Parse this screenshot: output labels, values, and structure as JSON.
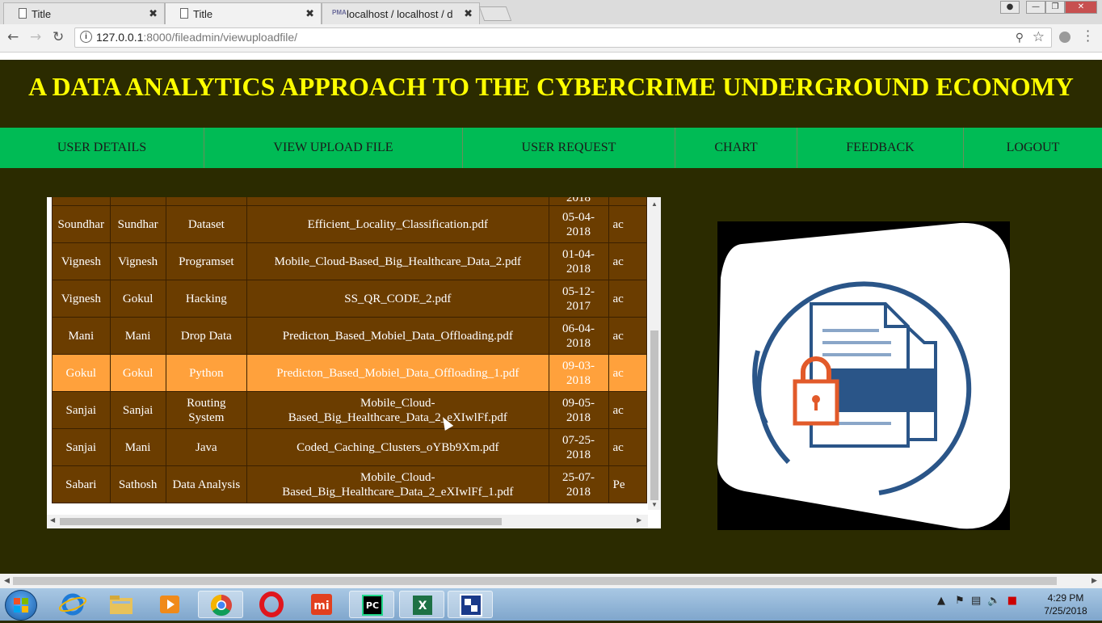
{
  "browser": {
    "tabs": [
      {
        "label": "Title",
        "close": "✖"
      },
      {
        "label": "Title",
        "close": "✖"
      },
      {
        "label": "localhost / localhost / da",
        "close": "✖",
        "badge": "PMA"
      }
    ],
    "url_host": "127.0.0.1",
    "url_rest": ":8000/fileadmin/viewuploadfile/",
    "info_icon": "i"
  },
  "page": {
    "title": "A DATA ANALYTICS APPROACH TO THE CYBERCRIME UNDERGROUND ECONOMY",
    "nav": [
      "USER DETAILS",
      "VIEW UPLOAD FILE",
      "USER REQUEST",
      "CHART",
      "FEEDBACK",
      "LOGOUT"
    ],
    "table": {
      "partial_top_date": "2018",
      "rows": [
        [
          "Soundhar",
          "Sundhar",
          "Dataset",
          "Efficient_Locality_Classification.pdf",
          "05-04-\n2018",
          "ac"
        ],
        [
          "Vignesh",
          "Vignesh",
          "Programset",
          "Mobile_Cloud-Based_Big_Healthcare_Data_2.pdf",
          "01-04-\n2018",
          "ac"
        ],
        [
          "Vignesh",
          "Gokul",
          "Hacking",
          "SS_QR_CODE_2.pdf",
          "05-12-\n2017",
          "ac"
        ],
        [
          "Mani",
          "Mani",
          "Drop Data",
          "Predicton_Based_Mobiel_Data_Offloading.pdf",
          "06-04-\n2018",
          "ac"
        ],
        [
          "Gokul",
          "Gokul",
          "Python",
          "Predicton_Based_Mobiel_Data_Offloading_1.pdf",
          "09-03-\n2018",
          "ac"
        ],
        [
          "Sanjai",
          "Sanjai",
          "Routing\nSystem",
          "Mobile_Cloud-\nBased_Big_Healthcare_Data_2_eXIwlFf.pdf",
          "09-05-\n2018",
          "ac"
        ],
        [
          "Sanjai",
          "Mani",
          "Java",
          "Coded_Caching_Clusters_oYBb9Xm.pdf",
          "07-25-\n2018",
          "ac"
        ],
        [
          "Sabari",
          "Sathosh",
          "Data Analysis",
          "Mobile_Cloud-\nBased_Big_Healthcare_Data_2_eXIwlFf_1.pdf",
          "25-07-\n2018",
          "Pe"
        ]
      ],
      "highlighted_row": 4
    }
  },
  "taskbar": {
    "apps": [
      "ie-icon",
      "explorer-icon",
      "media-player-icon",
      "chrome-icon",
      "opera-icon",
      "mi-icon",
      "pycharm-icon",
      "excel-icon",
      "app-icon"
    ],
    "pycharm_label": "PC",
    "time": "4:29 PM",
    "date": "7/25/2018"
  },
  "colors": {
    "header_bg": "#2b2b00",
    "title": "#ffff00",
    "nav_bg": "#00bb55",
    "row_bg": "#6b3d00",
    "row_highlight": "#ffa13c"
  }
}
